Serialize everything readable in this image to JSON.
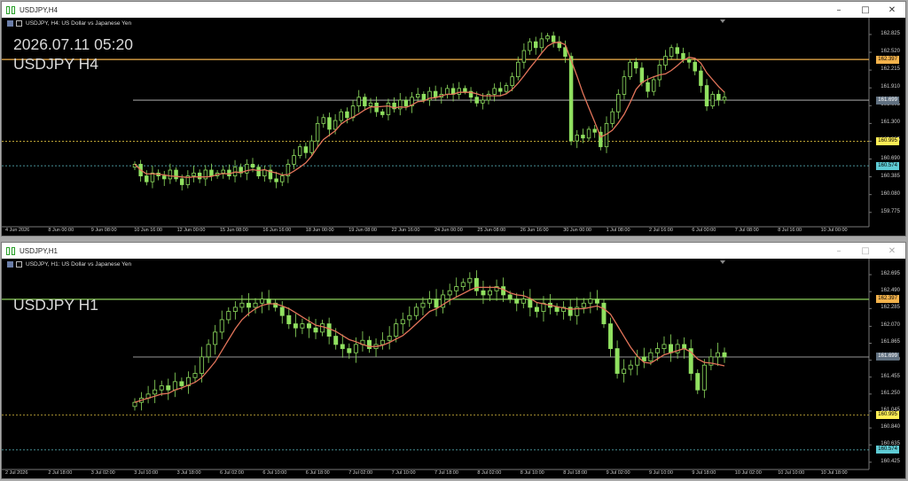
{
  "colors": {
    "bull": "#90e060",
    "line": "#f3b24b",
    "ma": "#e2745a",
    "level_gray": "#c8c8c8",
    "tag_current": "#607080",
    "tag_yellow": "#ffee55",
    "tag_cyan": "#5ecbd4",
    "hline_dotted": "#d9b24a"
  },
  "windows": [
    {
      "title": "USDJPY,H4",
      "header_text": "USDJPY, H4:  US Dollar vs Japanese Yen",
      "overlay_lines": [
        "2026.07.11 05:20",
        "USDJPY H4"
      ],
      "price_labels": [
        "162.825",
        "162.520",
        "162.215",
        "161.910",
        "161.605",
        "161.300",
        "160.995",
        "160.690",
        "160.385",
        "160.080",
        "159.775"
      ],
      "tags": {
        "orange": "162.397",
        "current": "161.699",
        "yellow": "160.995",
        "cyan": "160.574"
      },
      "time_labels": [
        "4 Jun 2026",
        "8 Jun 00:00",
        "9 Jun 08:00",
        "10 Jun 16:00",
        "12 Jun 00:00",
        "15 Jun 08:00",
        "16 Jun 16:00",
        "18 Jun 00:00",
        "19 Jun 08:00",
        "22 Jun 16:00",
        "24 Jun 00:00",
        "25 Jun 08:00",
        "26 Jun 16:00",
        "30 Jun 00:00",
        "1 Jul 08:00",
        "2 Jul 16:00",
        "6 Jul 00:00",
        "7 Jul 08:00",
        "8 Jul 16:00",
        "10 Jul 00:00"
      ]
    },
    {
      "title": "USDJPY,H1",
      "header_text": "USDJPY, H1:  US Dollar vs Japanese Yen",
      "overlay_lines": [
        "USDJPY H1"
      ],
      "price_labels": [
        "162.695",
        "162.490",
        "162.285",
        "162.070",
        "161.865",
        "161.660",
        "161.455",
        "161.250",
        "161.045",
        "160.840",
        "160.635",
        "160.425"
      ],
      "tags": {
        "orange": "162.397",
        "current": "161.699",
        "yellow": "160.995",
        "cyan": "160.574"
      },
      "time_labels": [
        "2 Jul 2026",
        "2 Jul 18:00",
        "3 Jul 02:00",
        "3 Jul 10:00",
        "3 Jul 18:00",
        "6 Jul 02:00",
        "6 Jul 10:00",
        "6 Jul 18:00",
        "7 Jul 02:00",
        "7 Jul 10:00",
        "7 Jul 18:00",
        "8 Jul 02:00",
        "8 Jul 10:00",
        "8 Jul 18:00",
        "9 Jul 02:00",
        "9 Jul 10:00",
        "9 Jul 18:00",
        "10 Jul 02:00",
        "10 Jul 10:00",
        "10 Jul 18:00"
      ]
    }
  ],
  "chart_data": [
    {
      "type": "candlestick",
      "symbol": "USDJPY",
      "timeframe": "H4",
      "ylim": [
        159.65,
        162.9
      ],
      "hlines": [
        162.397,
        161.699,
        160.995,
        160.574
      ],
      "series": [
        {
          "name": "close",
          "values": [
            160.6,
            160.4,
            160.3,
            160.45,
            160.4,
            160.35,
            160.5,
            160.35,
            160.25,
            160.4,
            160.45,
            160.35,
            160.5,
            160.4,
            160.45,
            160.5,
            160.4,
            160.55,
            160.45,
            160.6,
            160.55,
            160.4,
            160.5,
            160.35,
            160.3,
            160.4,
            160.6,
            160.75,
            160.9,
            160.8,
            161.0,
            161.3,
            161.4,
            161.2,
            161.35,
            161.5,
            161.4,
            161.6,
            161.75,
            161.6,
            161.65,
            161.5,
            161.45,
            161.65,
            161.55,
            161.7,
            161.6,
            161.75,
            161.8,
            161.7,
            161.85,
            161.75,
            161.8,
            161.9,
            161.8,
            161.9,
            161.85,
            161.75,
            161.65,
            161.7,
            161.8,
            161.9,
            161.85,
            161.95,
            162.1,
            162.35,
            162.55,
            162.7,
            162.6,
            162.75,
            162.8,
            162.7,
            162.6,
            162.45,
            161.0,
            161.1,
            161.05,
            161.2,
            161.15,
            160.9,
            161.3,
            161.5,
            161.8,
            162.1,
            162.35,
            162.25,
            162.0,
            161.85,
            162.05,
            162.3,
            162.45,
            162.6,
            162.5,
            162.4,
            162.35,
            162.2,
            161.95,
            161.6,
            161.8,
            161.7,
            161.75
          ]
        }
      ]
    },
    {
      "type": "candlestick",
      "symbol": "USDJPY",
      "timeframe": "H1",
      "ylim": [
        160.38,
        162.76
      ],
      "hlines": [
        162.397,
        161.699,
        160.995,
        160.574
      ],
      "series": [
        {
          "name": "close",
          "values": [
            161.15,
            161.2,
            161.25,
            161.3,
            161.35,
            161.3,
            161.4,
            161.35,
            161.45,
            161.5,
            161.7,
            161.85,
            162.0,
            162.15,
            162.25,
            162.3,
            162.35,
            162.3,
            162.35,
            162.4,
            162.35,
            162.3,
            162.2,
            162.1,
            162.05,
            162.1,
            162.05,
            162.0,
            162.1,
            161.95,
            161.85,
            161.8,
            161.75,
            161.85,
            161.9,
            161.8,
            161.85,
            161.9,
            161.95,
            162.1,
            162.15,
            162.2,
            162.3,
            162.35,
            162.4,
            162.3,
            162.45,
            162.5,
            162.55,
            162.6,
            162.65,
            162.5,
            162.45,
            162.5,
            162.55,
            162.45,
            162.4,
            162.35,
            162.4,
            162.3,
            162.25,
            162.35,
            162.3,
            162.25,
            162.3,
            162.2,
            162.3,
            162.35,
            162.4,
            162.35,
            162.1,
            161.8,
            161.5,
            161.55,
            161.6,
            161.7,
            161.65,
            161.75,
            161.8,
            161.85,
            161.75,
            161.85,
            161.8,
            161.5,
            161.3,
            161.6,
            161.7,
            161.75,
            161.7
          ]
        }
      ]
    }
  ]
}
